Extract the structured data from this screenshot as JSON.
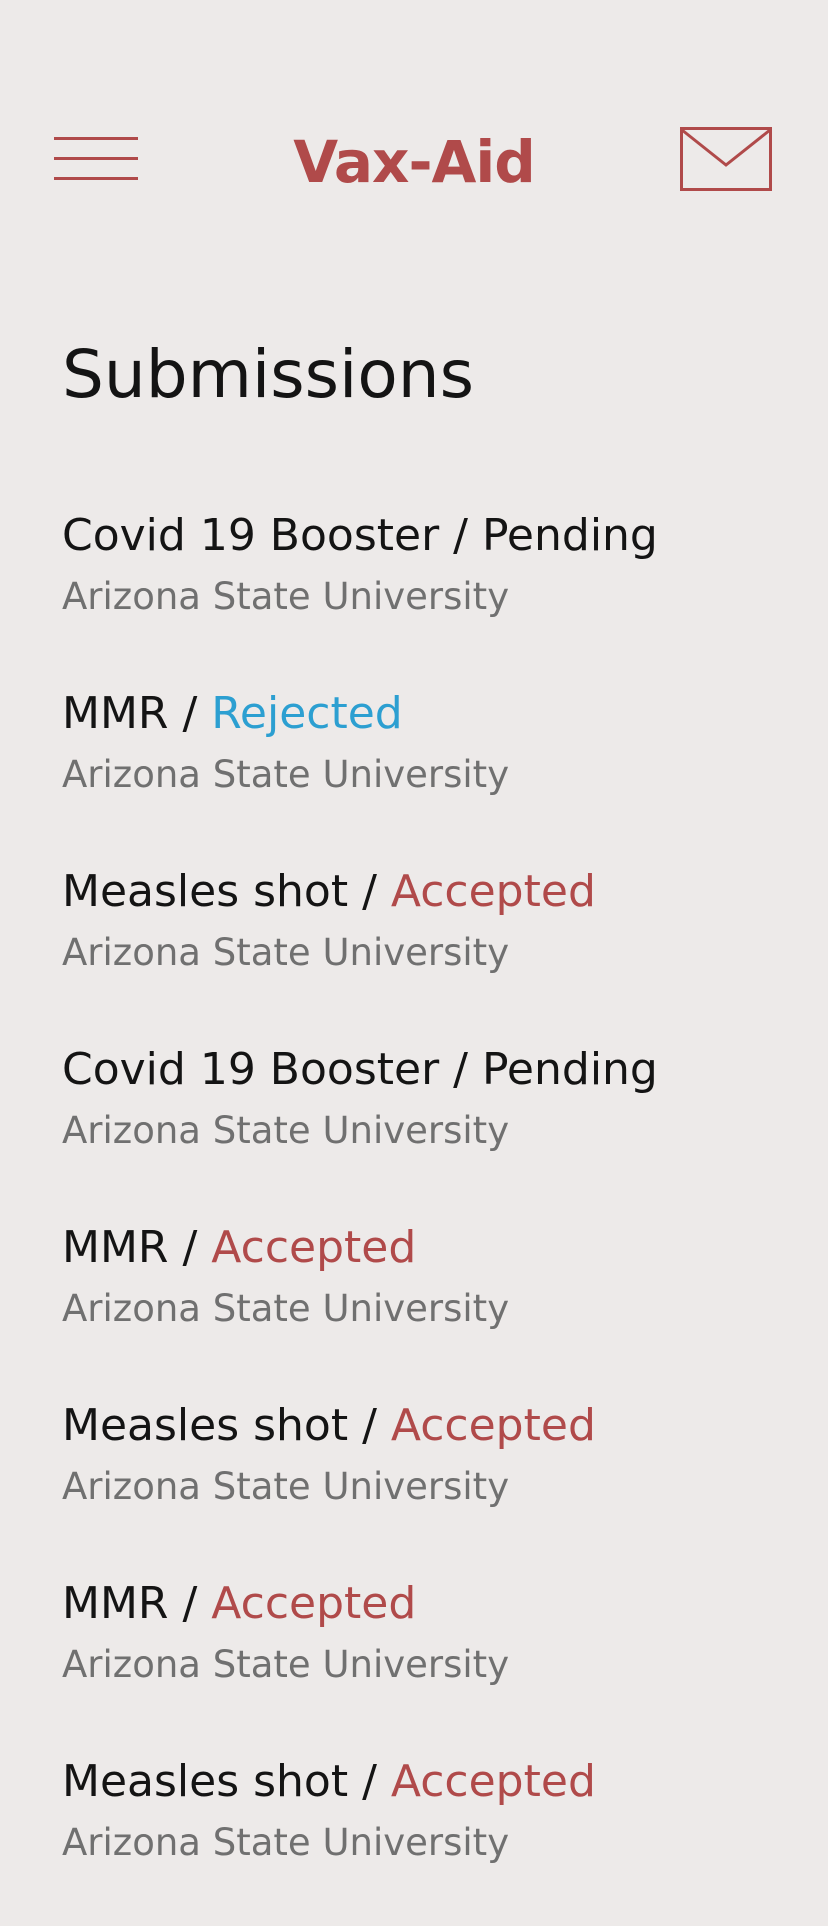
{
  "colors": {
    "background": "#EDEAE9",
    "brand": "#B04A4A",
    "accepted": "#B04A4A",
    "rejected": "#2C9FD1",
    "pending": "#141414",
    "secondary_text": "#707070"
  },
  "header": {
    "app_title": "Vax-Aid",
    "menu_icon": "hamburger-menu-icon",
    "mail_icon": "mail-icon"
  },
  "page": {
    "title": "Submissions"
  },
  "submissions": [
    {
      "vaccine": "Covid 19 Booster",
      "separator": " / ",
      "status": "Pending",
      "status_key": "pending",
      "institution": "Arizona State University"
    },
    {
      "vaccine": "MMR",
      "separator": " / ",
      "status": "Rejected",
      "status_key": "rejected",
      "institution": "Arizona State University"
    },
    {
      "vaccine": "Measles shot",
      "separator": " / ",
      "status": "Accepted",
      "status_key": "accepted",
      "institution": "Arizona State University"
    },
    {
      "vaccine": "Covid 19 Booster",
      "separator": " / ",
      "status": "Pending",
      "status_key": "pending",
      "institution": "Arizona State University"
    },
    {
      "vaccine": "MMR",
      "separator": " / ",
      "status": "Accepted",
      "status_key": "accepted",
      "institution": "Arizona State University"
    },
    {
      "vaccine": "Measles shot",
      "separator": " / ",
      "status": "Accepted",
      "status_key": "accepted",
      "institution": "Arizona State University"
    },
    {
      "vaccine": "MMR",
      "separator": " / ",
      "status": "Accepted",
      "status_key": "accepted",
      "institution": "Arizona State University"
    },
    {
      "vaccine": "Measles shot",
      "separator": " / ",
      "status": "Accepted",
      "status_key": "accepted",
      "institution": "Arizona State University"
    }
  ]
}
